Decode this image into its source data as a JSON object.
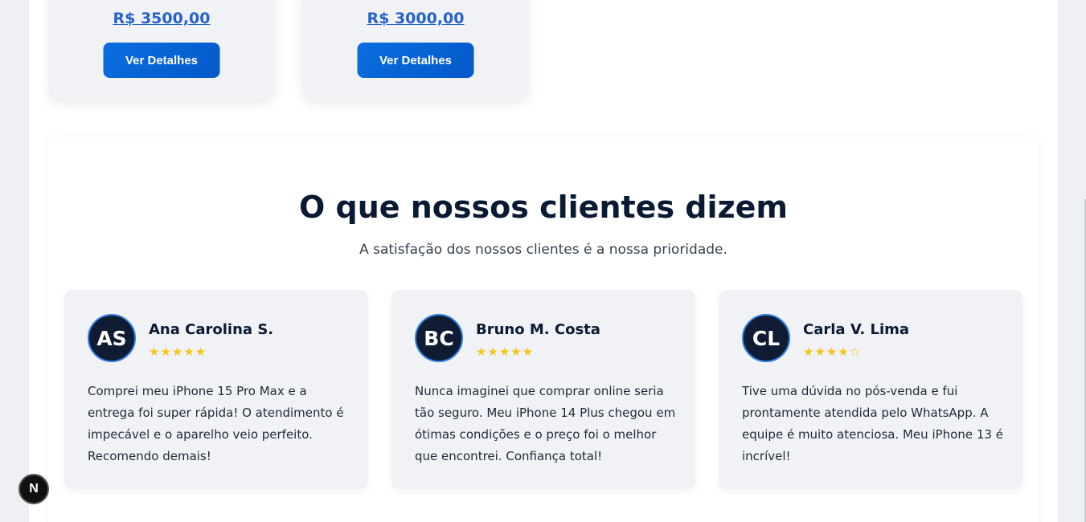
{
  "products": [
    {
      "price": "R$ 3500,00",
      "button_label": "Ver Detalhes"
    },
    {
      "price": "R$ 3000,00",
      "button_label": "Ver Detalhes"
    }
  ],
  "testimonials": {
    "title": "O que nossos clientes dizem",
    "subtitle": "A satisfação dos nossos clientes é a nossa prioridade.",
    "reviews": [
      {
        "initials": "AS",
        "name": "Ana Carolina S.",
        "stars": "★★★★★",
        "rating": 5,
        "text": "Comprei meu iPhone 15 Pro Max e a entrega foi super rápida! O atendimento é impecável e o aparelho veio perfeito. Recomendo demais!"
      },
      {
        "initials": "BC",
        "name": "Bruno M. Costa",
        "stars": "★★★★★",
        "rating": 5,
        "text": "Nunca imaginei que comprar online seria tão seguro. Meu iPhone 14 Plus chegou em ótimas condições e o preço foi o melhor que encontrei. Confiança total!"
      },
      {
        "initials": "CL",
        "name": "Carla V. Lima",
        "stars": "★★★★☆",
        "rating": 4,
        "text": "Tive uma dúvida no pós-venda e fui prontamente atendida pelo WhatsApp. A equipe é muito atenciosa. Meu iPhone 13 é incrível!"
      }
    ]
  },
  "dev_badge": {
    "letter": "N",
    "icon": "nextjs-icon"
  },
  "colors": {
    "accent": "#0a6ee0",
    "price": "#2563c9",
    "star": "#f5c518",
    "avatar_bg": "#0f1c33"
  }
}
